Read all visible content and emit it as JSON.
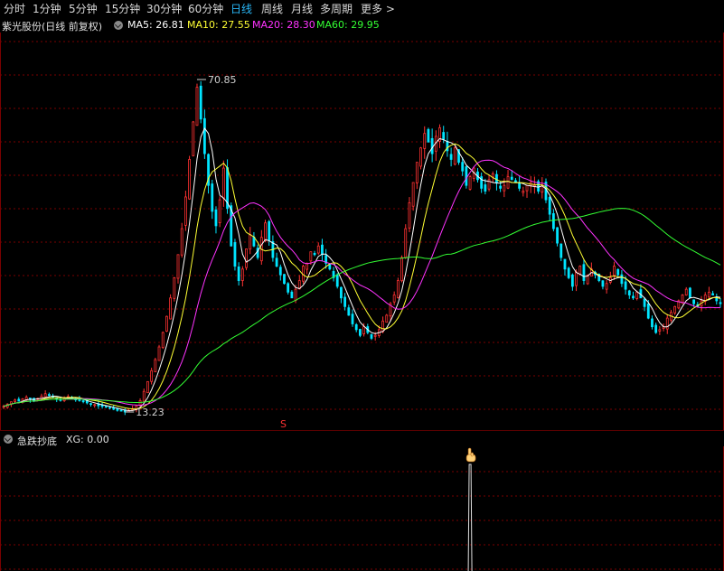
{
  "tabs": [
    {
      "label": "分时",
      "active": false
    },
    {
      "label": "1分钟",
      "active": false
    },
    {
      "label": "5分钟",
      "active": false
    },
    {
      "label": "15分钟",
      "active": false
    },
    {
      "label": "30分钟",
      "active": false
    },
    {
      "label": "60分钟",
      "active": false
    },
    {
      "label": "日线",
      "active": true
    },
    {
      "label": "周线",
      "active": false
    },
    {
      "label": "月线",
      "active": false
    },
    {
      "label": "多周期",
      "active": false
    },
    {
      "label": "更多 >",
      "active": false
    }
  ],
  "stock": {
    "name": "紫光股份(日线 前复权)"
  },
  "ma": [
    {
      "label": "MA5: 26.81",
      "color": "#ffffff"
    },
    {
      "label": "MA10: 27.55",
      "color": "#ffff33"
    },
    {
      "label": "MA20: 28.30",
      "color": "#ff33ff"
    },
    {
      "label": "MA60: 29.95",
      "color": "#33ff33"
    }
  ],
  "annotations": {
    "high": "70.85",
    "low": "13.23",
    "marker": "S"
  },
  "indicator": {
    "name": "急跌抄底",
    "value": "XG: 0.00"
  },
  "colors": {
    "up": "#ff3232",
    "down": "#00e5ff",
    "grid": "#7a0000",
    "accent": "#29b6f6"
  },
  "chart_data": {
    "type": "candlestick",
    "high_label": 70.85,
    "low_label": 13.23,
    "ma_values": {
      "MA5": 26.81,
      "MA10": 27.55,
      "MA20": 28.3,
      "MA60": 29.95
    },
    "close_series": [
      14.2,
      14.6,
      15.0,
      15.3,
      15.1,
      15.5,
      15.8,
      15.4,
      15.2,
      15.6,
      16.0,
      16.4,
      16.1,
      15.8,
      15.5,
      15.3,
      15.6,
      15.9,
      15.7,
      15.4,
      15.2,
      15.0,
      14.8,
      14.6,
      14.5,
      14.3,
      14.2,
      14.1,
      13.9,
      13.7,
      13.5,
      13.4,
      13.23,
      13.5,
      13.8,
      14.3,
      15.2,
      16.8,
      18.5,
      20.4,
      22.3,
      24.5,
      27.0,
      29.8,
      33.0,
      36.5,
      40.5,
      45.0,
      50.5,
      57.0,
      63.5,
      69.5,
      64.0,
      58.0,
      52.5,
      48.0,
      45.5,
      50.0,
      55.5,
      48.5,
      42.0,
      38.5,
      36.0,
      38.0,
      41.5,
      44.0,
      42.0,
      40.0,
      43.5,
      46.0,
      43.0,
      40.0,
      38.5,
      37.0,
      35.5,
      34.0,
      33.0,
      34.5,
      36.0,
      38.5,
      39.0,
      41.0,
      40.5,
      42.0,
      40.5,
      39.0,
      38.0,
      36.5,
      35.0,
      33.0,
      31.5,
      30.0,
      28.5,
      27.5,
      26.5,
      28.0,
      27.0,
      26.0,
      26.5,
      27.5,
      29.0,
      30.0,
      32.0,
      33.5,
      36.0,
      40.0,
      45.0,
      49.5,
      53.0,
      56.5,
      59.0,
      61.5,
      60.0,
      58.0,
      61.0,
      62.5,
      60.5,
      58.5,
      57.0,
      59.0,
      56.5,
      55.0,
      52.5,
      54.0,
      55.5,
      53.5,
      52.0,
      51.5,
      53.5,
      54.5,
      53.0,
      52.0,
      52.5,
      54.0,
      53.5,
      53.0,
      52.0,
      51.5,
      52.5,
      53.0,
      52.5,
      51.5,
      52.5,
      50.0,
      47.5,
      45.0,
      42.5,
      40.0,
      38.0,
      36.5,
      35.0,
      37.5,
      38.5,
      36.0,
      37.0,
      38.0,
      37.0,
      36.0,
      35.0,
      35.5,
      36.5,
      38.5,
      37.0,
      35.5,
      34.5,
      33.5,
      33.0,
      34.0,
      33.0,
      31.5,
      29.5,
      28.0,
      27.0,
      27.5,
      28.0,
      29.5,
      30.5,
      31.5,
      32.5,
      33.5,
      34.5,
      33.0,
      32.0,
      31.5,
      32.5,
      33.5,
      34.0,
      33.5,
      32.5,
      32.0
    ],
    "signal_index": 123
  }
}
